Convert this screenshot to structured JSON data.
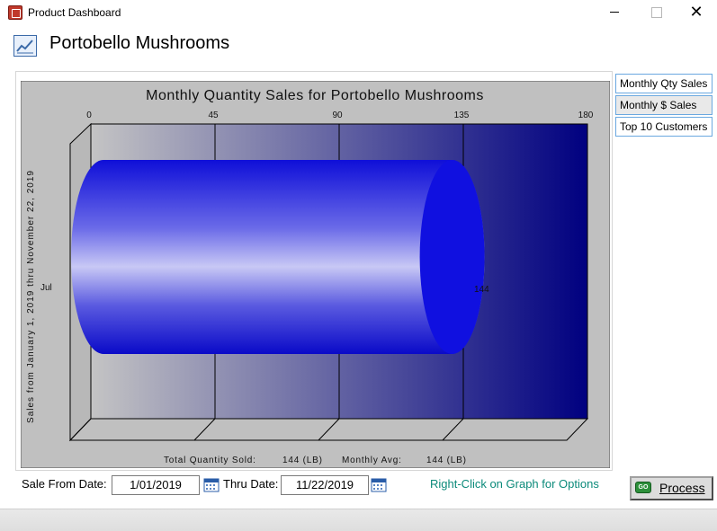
{
  "window": {
    "title": "Product Dashboard",
    "minimize": "",
    "maximize": "",
    "close": "✕"
  },
  "header": {
    "title": "Portobello Mushrooms",
    "icon": "chart-icon"
  },
  "side_buttons": [
    {
      "label": "Monthly Qty Sales",
      "active": false
    },
    {
      "label": "Monthly $ Sales",
      "active": true
    },
    {
      "label": "Top 10 Customers",
      "active": false
    }
  ],
  "chart_data": {
    "type": "bar",
    "orientation": "horizontal",
    "style": "3d-cylinder",
    "title": "Monthly Quantity Sales for Portobello Mushrooms",
    "ylabel": "Sales from January 1, 2019     thru November 22, 2019",
    "categories": [
      "Jul"
    ],
    "values": [
      144
    ],
    "xlim": [
      0,
      180
    ],
    "xticks": [
      "0",
      "45",
      "90",
      "135",
      "180"
    ],
    "data_labels": [
      "144"
    ],
    "footer": {
      "total_label": "Total Quantity Sold:",
      "total_value": "144 (LB)",
      "avg_label": "Monthly Avg:",
      "avg_value": "144 (LB)"
    },
    "colors": {
      "bar": "#1a1ae0",
      "background_dark": "#000080",
      "background_light": "#c0c0c0",
      "panel": "#c0c0c0"
    }
  },
  "filters": {
    "from_label": "Sale From Date:",
    "from_value": "1/01/2019",
    "thru_label": "Thru Date:",
    "thru_value": "11/22/2019",
    "hint": "Right-Click on Graph for Options"
  },
  "process": {
    "label": "Process",
    "icon_text": "GO"
  }
}
